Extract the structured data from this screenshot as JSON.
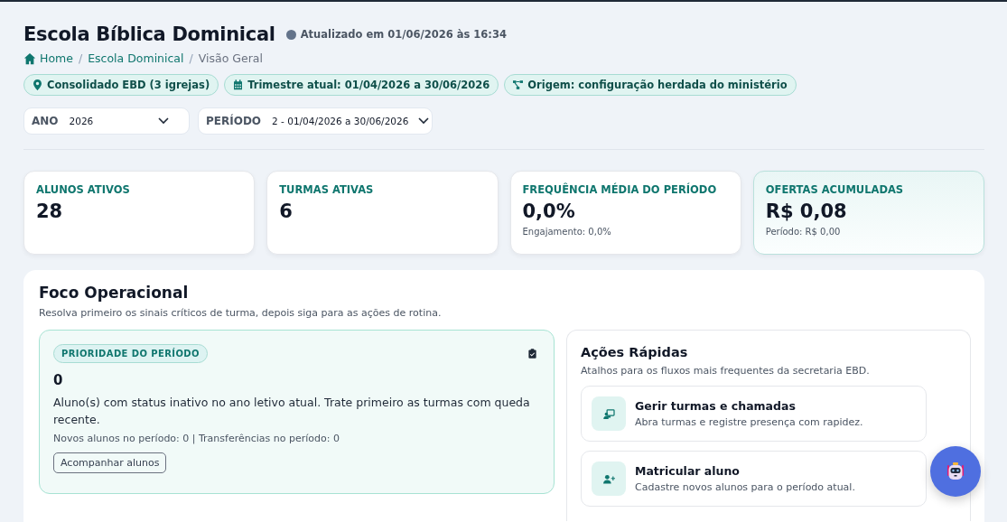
{
  "header": {
    "title": "Escola Bíblica Dominical",
    "updated": "Atualizado em 01/06/2026 às 16:34"
  },
  "breadcrumb": [
    {
      "label": "Home",
      "kind": "home"
    },
    {
      "separator": "/",
      "label": "Escola Dominical",
      "kind": "link"
    },
    {
      "separator": "/",
      "label": "Visão Geral",
      "kind": "current"
    }
  ],
  "chips": [
    {
      "label": "Consolidado EBD (3 igrejas)",
      "kind": "location"
    },
    {
      "label": "Trimestre atual: 01/04/2026 a 30/06/2026",
      "kind": "calendar"
    },
    {
      "label": "Origem: configuração herdada do ministério",
      "kind": "hierarchy"
    }
  ],
  "filters": [
    {
      "label": "ANO",
      "value": "2026"
    },
    {
      "label": "PERÍODO",
      "value": "2 - 01/04/2026 a 30/06/2026"
    }
  ],
  "stats": [
    {
      "label": "ALUNOS ATIVOS",
      "value": "28",
      "highlighted": false
    },
    {
      "label": "TURMAS ATIVAS",
      "value": "6",
      "highlighted": false
    },
    {
      "label": "FREQUÊNCIA MÉDIA DO PERÍODO",
      "value": "0,0%",
      "note": "Engajamento: 0,0%",
      "highlighted": false
    },
    {
      "label": "OFERTAS ACUMULADAS",
      "value": "R$ 0,08",
      "note": "Período: R$ 0,00",
      "highlighted": true
    }
  ],
  "focus": {
    "title": "Foco Operacional",
    "subtitle": "Resolva primeiro os sinais críticos de turma, depois siga para as ações de rotina.",
    "priority": {
      "badge": "PRIORIDADE DO PERÍODO",
      "value": "0",
      "text": "Aluno(s) com status inativo no ano letivo atual. Trate primeiro as turmas com queda recente.",
      "meta": "Novos alunos no período: 0 | Transferências no período: 0",
      "button": "Acompanhar alunos"
    },
    "quick_actions": {
      "title": "Ações Rápidas",
      "subtitle": "Atalhos para os fluxos mais frequentes da secretaria EBD.",
      "items": [
        {
          "title": "Gerir turmas e chamadas",
          "text": "Abra turmas e registre presença com rapidez.",
          "kind": "class"
        },
        {
          "title": "Matricular aluno",
          "text": "Cadastre novos alunos para o período atual.",
          "kind": "enroll"
        }
      ]
    }
  }
}
